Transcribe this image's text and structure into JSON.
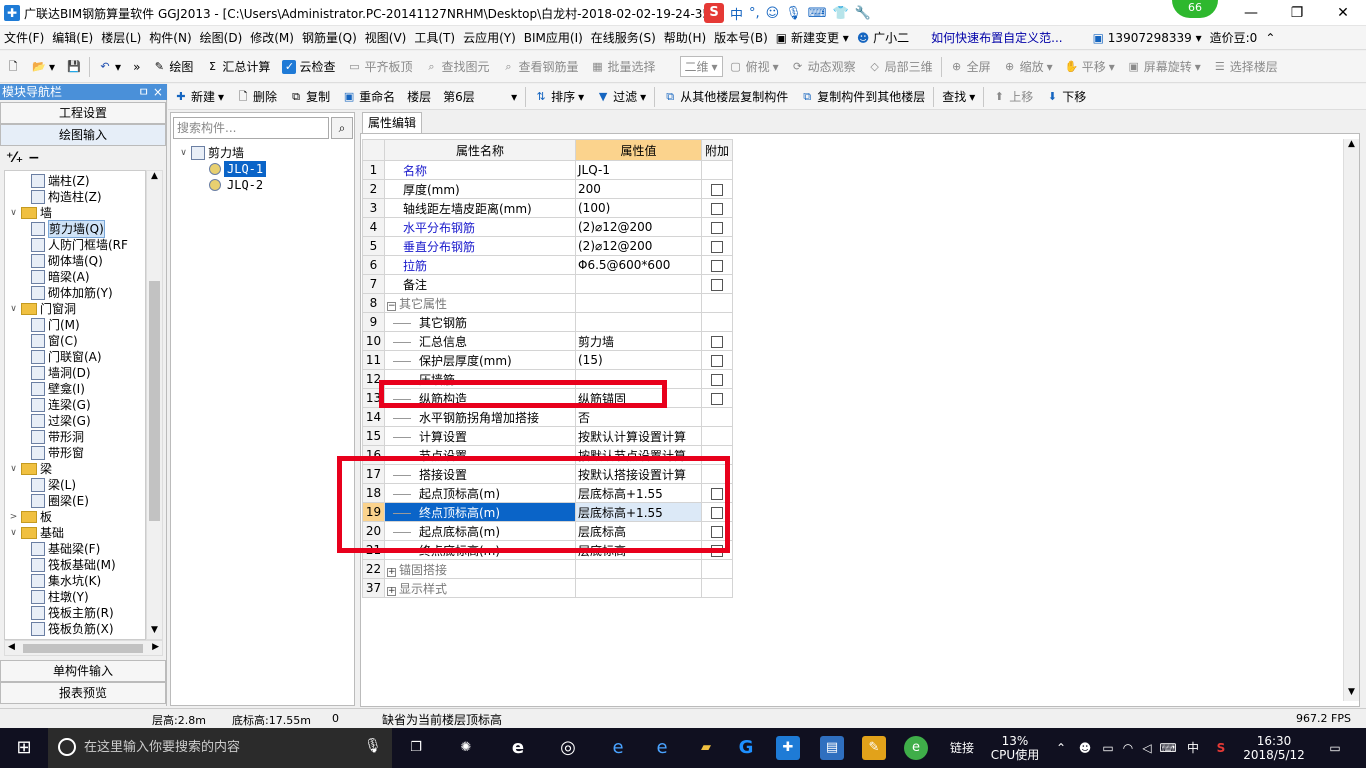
{
  "window": {
    "title": "广联达BIM钢筋算量软件 GGJ2013 - [C:\\Users\\Administrator.PC-20141127NRHM\\Desktop\\白龙村-2018-02-02-19-24-35",
    "badge": "66",
    "ime": {
      "s": "S",
      "zh": "中",
      "dot": "°,"
    }
  },
  "menu": {
    "items": [
      "文件(F)",
      "编辑(E)",
      "楼层(L)",
      "构件(N)",
      "绘图(D)",
      "修改(M)",
      "钢筋量(Q)",
      "视图(V)",
      "工具(T)",
      "云应用(Y)",
      "BIM应用(I)",
      "在线服务(S)",
      "帮助(H)",
      "版本号(B)",
      "新建变更",
      "广小二"
    ],
    "hint": "如何快速布置自定义范...",
    "phone": "13907298339",
    "price": "造价豆:0"
  },
  "toolbar1": {
    "draw": "绘图",
    "sum": "汇总计算",
    "cloud_check": "云检查",
    "flat_top": "平齐板顶",
    "find_elem": "查找图元",
    "view_rebar": "查看钢筋量",
    "batch_select": "批量选择",
    "view_mode": "二维",
    "top_view": "俯视",
    "dynamic": "动态观察",
    "local3d": "局部三维",
    "fullscreen": "全屏",
    "zoom": "缩放",
    "pan": "平移",
    "rotate": "屏幕旋转",
    "select_floor": "选择楼层"
  },
  "nav": {
    "header": "模块导航栏",
    "pin": "ㅁ ×",
    "project_settings": "工程设置",
    "drawing_input": "绘图输入",
    "single_input": "单构件输入",
    "report_preview": "报表预览",
    "tree": [
      {
        "label": "端柱(Z)",
        "level": 2,
        "type": "item"
      },
      {
        "label": "构造柱(Z)",
        "level": 2,
        "type": "item"
      },
      {
        "label": "墙",
        "level": 1,
        "type": "folder",
        "exp": "∨"
      },
      {
        "label": "剪力墙(Q)",
        "level": 2,
        "type": "item",
        "sel": true
      },
      {
        "label": "人防门框墙(RF",
        "level": 2,
        "type": "item"
      },
      {
        "label": "砌体墙(Q)",
        "level": 2,
        "type": "item"
      },
      {
        "label": "暗梁(A)",
        "level": 2,
        "type": "item"
      },
      {
        "label": "砌体加筋(Y)",
        "level": 2,
        "type": "item"
      },
      {
        "label": "门窗洞",
        "level": 1,
        "type": "folder",
        "exp": "∨"
      },
      {
        "label": "门(M)",
        "level": 2,
        "type": "item"
      },
      {
        "label": "窗(C)",
        "level": 2,
        "type": "item"
      },
      {
        "label": "门联窗(A)",
        "level": 2,
        "type": "item"
      },
      {
        "label": "墙洞(D)",
        "level": 2,
        "type": "item"
      },
      {
        "label": "壁龛(I)",
        "level": 2,
        "type": "item"
      },
      {
        "label": "连梁(G)",
        "level": 2,
        "type": "item"
      },
      {
        "label": "过梁(G)",
        "level": 2,
        "type": "item"
      },
      {
        "label": "带形洞",
        "level": 2,
        "type": "item"
      },
      {
        "label": "带形窗",
        "level": 2,
        "type": "item"
      },
      {
        "label": "梁",
        "level": 1,
        "type": "folder",
        "exp": "∨"
      },
      {
        "label": "梁(L)",
        "level": 2,
        "type": "item"
      },
      {
        "label": "圈梁(E)",
        "level": 2,
        "type": "item"
      },
      {
        "label": "板",
        "level": 1,
        "type": "folder",
        "exp": ">"
      },
      {
        "label": "基础",
        "level": 1,
        "type": "folder",
        "exp": "∨"
      },
      {
        "label": "基础梁(F)",
        "level": 2,
        "type": "item"
      },
      {
        "label": "筏板基础(M)",
        "level": 2,
        "type": "item"
      },
      {
        "label": "集水坑(K)",
        "level": 2,
        "type": "item"
      },
      {
        "label": "柱墩(Y)",
        "level": 2,
        "type": "item"
      },
      {
        "label": "筏板主筋(R)",
        "level": 2,
        "type": "item"
      },
      {
        "label": "筏板负筋(X)",
        "level": 2,
        "type": "item"
      }
    ]
  },
  "toolbar2": {
    "new": "新建",
    "delete": "删除",
    "copy": "复制",
    "rename": "重命名",
    "floor_label": "楼层",
    "floor_value": "第6层",
    "sort": "排序",
    "filter": "过滤",
    "copy_from": "从其他楼层复制构件",
    "copy_to": "复制构件到其他楼层",
    "find": "查找",
    "move_up": "上移",
    "move_down": "下移"
  },
  "components": {
    "search_placeholder": "搜索构件...",
    "root": "剪力墙",
    "items": [
      "JLQ-1",
      "JLQ-2"
    ]
  },
  "props": {
    "tab": "属性编辑",
    "headers": {
      "name": "属性名称",
      "value": "属性值",
      "extra": "附加"
    },
    "rows": [
      {
        "n": "1",
        "name": "名称",
        "value": "JLQ-1",
        "blue": true,
        "cb": false
      },
      {
        "n": "2",
        "name": "厚度(mm)",
        "value": "200",
        "cb": true
      },
      {
        "n": "3",
        "name": "轴线距左墙皮距离(mm)",
        "value": "(100)",
        "cb": true
      },
      {
        "n": "4",
        "name": "水平分布钢筋",
        "value": "(2)⌀12@200",
        "blue": true,
        "cb": true
      },
      {
        "n": "5",
        "name": "垂直分布钢筋",
        "value": "(2)⌀12@200",
        "blue": true,
        "cb": true
      },
      {
        "n": "6",
        "name": "拉筋",
        "value": "Φ6.5@600*600",
        "blue": true,
        "cb": true
      },
      {
        "n": "7",
        "name": "备注",
        "value": "",
        "cb": true
      },
      {
        "n": "8",
        "name": "其它属性",
        "value": "",
        "group": true,
        "pm": "−"
      },
      {
        "n": "9",
        "name": "其它钢筋",
        "value": "",
        "sub": true
      },
      {
        "n": "10",
        "name": "汇总信息",
        "value": "剪力墙",
        "sub": true,
        "cb": true
      },
      {
        "n": "11",
        "name": "保护层厚度(mm)",
        "value": "(15)",
        "sub": true,
        "cb": true
      },
      {
        "n": "12",
        "name": "压墙筋",
        "value": "",
        "sub": true,
        "cb": true
      },
      {
        "n": "13",
        "name": "纵筋构造",
        "value": "纵筋锚固",
        "sub": true,
        "cb": true
      },
      {
        "n": "14",
        "name": "水平钢筋拐角增加搭接",
        "value": "否",
        "sub": true
      },
      {
        "n": "15",
        "name": "计算设置",
        "value": "按默认计算设置计算",
        "sub": true
      },
      {
        "n": "16",
        "name": "节点设置",
        "value": "按默认节点设置计算",
        "sub": true
      },
      {
        "n": "17",
        "name": "搭接设置",
        "value": "按默认搭接设置计算",
        "sub": true
      },
      {
        "n": "18",
        "name": "起点顶标高(m)",
        "value": "层底标高+1.55",
        "sub": true,
        "cb": true
      },
      {
        "n": "19",
        "name": "终点顶标高(m)",
        "value": "层底标高+1.55",
        "sub": true,
        "cb": true,
        "sel": true
      },
      {
        "n": "20",
        "name": "起点底标高(m)",
        "value": "层底标高",
        "sub": true,
        "cb": true
      },
      {
        "n": "21",
        "name": "终点底标高(m)",
        "value": "层底标高",
        "sub": true,
        "cb": true
      },
      {
        "n": "22",
        "name": "锚固搭接",
        "value": "",
        "group": true,
        "pm": "+"
      },
      {
        "n": "37",
        "name": "显示样式",
        "value": "",
        "group": true,
        "pm": "+"
      }
    ]
  },
  "status": {
    "floor_height": "层高:2.8m",
    "base_elev": "底标高:17.55m",
    "zero": "0",
    "message": "缺省为当前楼层顶标高",
    "fps": "967.2 FPS"
  },
  "taskbar": {
    "search_placeholder": "在这里输入你要搜索的内容",
    "link": "链接",
    "cpu_pct": "13%",
    "cpu_label": "CPU使用",
    "ime": "中",
    "time": "16:30",
    "date": "2018/5/12"
  }
}
